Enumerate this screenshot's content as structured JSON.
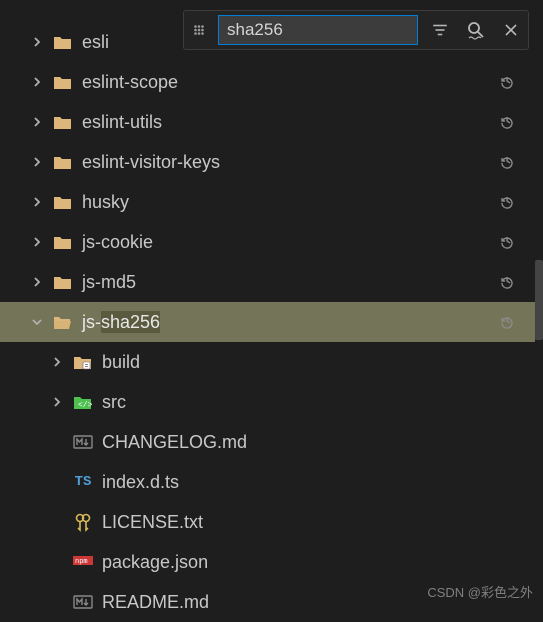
{
  "search": {
    "value": "sha256"
  },
  "tree": [
    {
      "kind": "folder",
      "label": "esli",
      "depth": 0,
      "expanded": false,
      "restore": true,
      "nodeName": "folder-esli",
      "hl": false
    },
    {
      "kind": "folder",
      "label": "eslint-scope",
      "depth": 0,
      "expanded": false,
      "restore": true,
      "nodeName": "folder-eslint-scope",
      "hl": false
    },
    {
      "kind": "folder",
      "label": "eslint-utils",
      "depth": 0,
      "expanded": false,
      "restore": true,
      "nodeName": "folder-eslint-utils",
      "hl": false
    },
    {
      "kind": "folder",
      "label": "eslint-visitor-keys",
      "depth": 0,
      "expanded": false,
      "restore": true,
      "nodeName": "folder-eslint-visitor-keys",
      "hl": false
    },
    {
      "kind": "folder",
      "label": "husky",
      "depth": 0,
      "expanded": false,
      "restore": true,
      "nodeName": "folder-husky",
      "hl": false
    },
    {
      "kind": "folder",
      "label": "js-cookie",
      "depth": 0,
      "expanded": false,
      "restore": true,
      "nodeName": "folder-js-cookie",
      "hl": false
    },
    {
      "kind": "folder",
      "label": "js-md5",
      "depth": 0,
      "expanded": false,
      "restore": true,
      "nodeName": "folder-js-md5",
      "hl": false
    },
    {
      "kind": "folder-open",
      "label": "js-sha256",
      "depth": 0,
      "expanded": true,
      "restore": true,
      "nodeName": "folder-js-sha256",
      "hl": true,
      "hlStart": 3,
      "hlLen": 6,
      "selected": true
    },
    {
      "kind": "folder",
      "label": "build",
      "depth": 1,
      "expanded": false,
      "iconColor": "#dcb67a",
      "overlay": true,
      "nodeName": "folder-build"
    },
    {
      "kind": "folder",
      "label": "src",
      "depth": 1,
      "expanded": false,
      "iconColor": "#4ec14e",
      "overlaySrc": true,
      "nodeName": "folder-src"
    },
    {
      "kind": "file-md",
      "label": "CHANGELOG.md",
      "depth": 1,
      "nodeName": "file-changelog"
    },
    {
      "kind": "file-ts",
      "label": "index.d.ts",
      "depth": 1,
      "nodeName": "file-index-dts"
    },
    {
      "kind": "file-license",
      "label": "LICENSE.txt",
      "depth": 1,
      "nodeName": "file-license"
    },
    {
      "kind": "file-npm",
      "label": "package.json",
      "depth": 1,
      "nodeName": "file-package-json"
    },
    {
      "kind": "file-md",
      "label": "README.md",
      "depth": 1,
      "nodeName": "file-readme"
    }
  ],
  "watermark": "CSDN @彩色之外"
}
